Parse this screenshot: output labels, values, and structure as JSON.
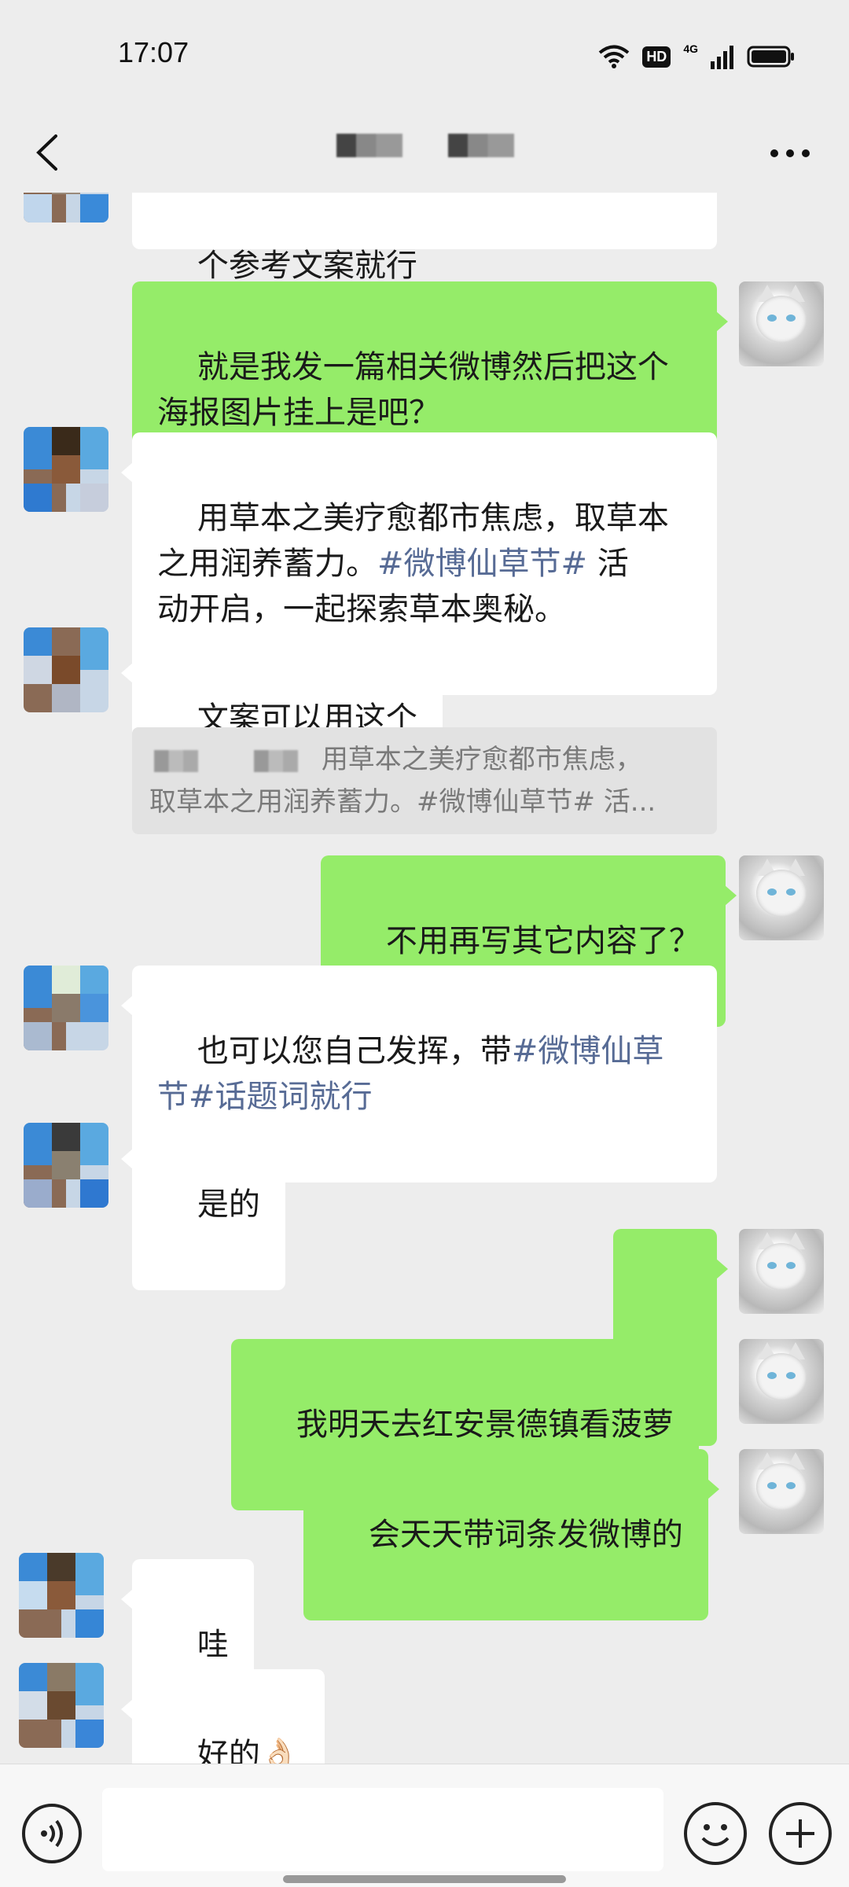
{
  "status_bar": {
    "time": "17:07",
    "hd": "HD",
    "network": "4G",
    "icons": [
      "wifi-icon",
      "signal-icon",
      "battery-icon"
    ]
  },
  "header": {
    "title": "",
    "back_icon": "chevron-left-icon",
    "more_icon": "more-icon"
  },
  "messages": [
    {
      "side": "in",
      "text": "个参考文案就行"
    },
    {
      "side": "out",
      "text": "就是我发一篇相关微博然后把这个\n海报图片挂上是吧？"
    },
    {
      "side": "in",
      "text_before": "用草本之美疗愈都市焦虑，取草本\n之用润养蓄力。",
      "hashtag": "#微博仙草节#",
      "text_after": " 活\n动开启，一起探索草本奥秘。"
    },
    {
      "side": "in",
      "text": "文案可以用这个",
      "quote_line1": "用草本之美疗愈都市焦虑，",
      "quote_line2": "取草本之用润养蓄力。#微博仙草节# 活..."
    },
    {
      "side": "out",
      "text": "不用再写其它内容了？"
    },
    {
      "side": "in",
      "text_before": "也可以您自己发挥，带",
      "hashtag": "#微博仙草\n节#",
      "text_after": "话题词就行"
    },
    {
      "side": "in",
      "text": "是的"
    },
    {
      "side": "out",
      "text": "👌"
    },
    {
      "side": "out",
      "text": "我明天去红安景德镇看菠萝"
    },
    {
      "side": "out",
      "text": "会天天带词条发微博的"
    },
    {
      "side": "in",
      "text": "哇"
    },
    {
      "side": "in",
      "text": "好的👌🏻"
    }
  ],
  "colors": {
    "background": "#ededed",
    "bubble_out": "#95ec69",
    "bubble_in": "#ffffff",
    "hashtag": "#576b95"
  },
  "input_bar": {
    "value": "",
    "voice_icon": "voice-icon",
    "emoji_icon": "emoji-icon",
    "plus_icon": "plus-icon"
  }
}
